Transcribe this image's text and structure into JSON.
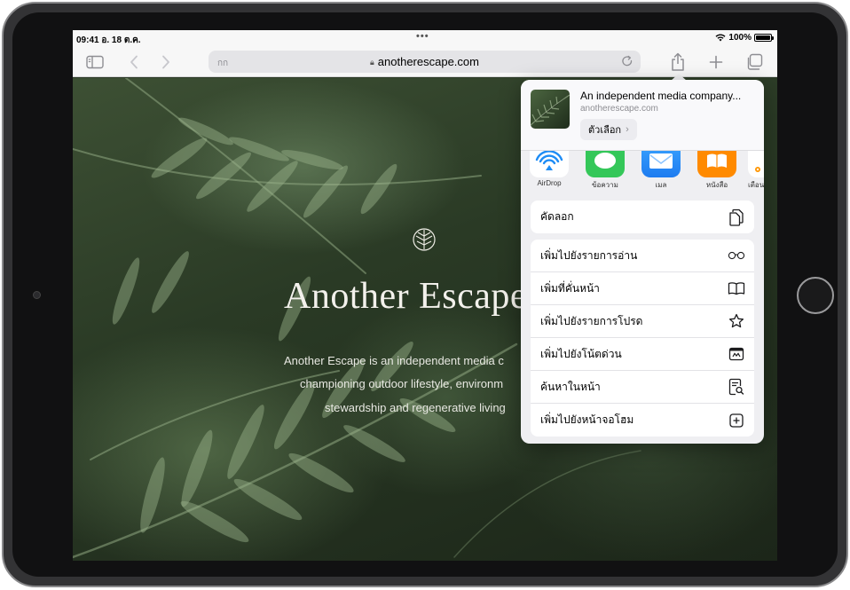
{
  "status_bar": {
    "time": "09:41  อ. 18 ต.ค.",
    "dots": "•••",
    "battery": "100%"
  },
  "toolbar": {
    "aa_label": "กก",
    "url": "anotherescape.com"
  },
  "webpage": {
    "title": "Another Escape",
    "line1": "Another Escape is an independent media c",
    "line2": "championing outdoor lifestyle, environm",
    "line3": "stewardship and regenerative living"
  },
  "share_sheet": {
    "title": "An independent media company...",
    "domain": "anotherescape.com",
    "options_label": "ตัวเลือก",
    "apps": [
      {
        "label": "AirDrop",
        "icon": "airdrop-icon"
      },
      {
        "label": "ข้อความ",
        "icon": "messages-icon"
      },
      {
        "label": "เมล",
        "icon": "mail-icon"
      },
      {
        "label": "หนังสือ",
        "icon": "books-icon"
      },
      {
        "label": "เตือนความจำ",
        "icon": "reminders-icon"
      }
    ],
    "copy_label": "คัดลอก",
    "actions": [
      {
        "label": "เพิ่มไปยังรายการอ่าน",
        "icon": "glasses-icon"
      },
      {
        "label": "เพิ่มที่คั่นหน้า",
        "icon": "book-icon"
      },
      {
        "label": "เพิ่มไปยังรายการโปรด",
        "icon": "star-icon"
      },
      {
        "label": "เพิ่มไปยังโน้ตด่วน",
        "icon": "quick-note-icon"
      },
      {
        "label": "ค้นหาในหน้า",
        "icon": "find-in-page-icon"
      },
      {
        "label": "เพิ่มไปยังหน้าจอโฮม",
        "icon": "add-square-icon"
      }
    ]
  },
  "colors": {
    "messages": "#34c759",
    "mail": "#1e8cf5",
    "books": "#ff8a00",
    "airdrop": "#1e8cf5"
  }
}
